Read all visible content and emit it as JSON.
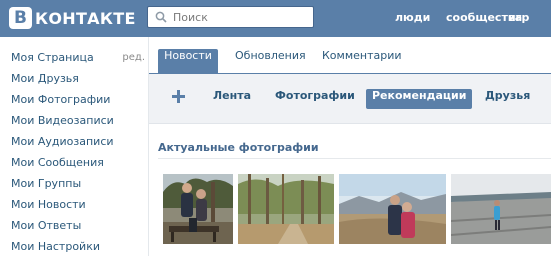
{
  "header": {
    "logo_letter": "В",
    "logo_text": "КОНТАКТЕ",
    "search_placeholder": "Поиск",
    "links": [
      "люди",
      "сообщества",
      "игр"
    ]
  },
  "left_menu": {
    "items": [
      {
        "label": "Моя Страница",
        "edit": "ред."
      },
      {
        "label": "Мои Друзья"
      },
      {
        "label": "Мои Фотографии"
      },
      {
        "label": "Мои Видеозаписи"
      },
      {
        "label": "Мои Аудиозаписи"
      },
      {
        "label": "Мои Сообщения"
      },
      {
        "label": "Мои Группы"
      },
      {
        "label": "Мои Новости"
      },
      {
        "label": "Мои Ответы"
      },
      {
        "label": "Мои Настройки"
      }
    ]
  },
  "tabs": [
    "Новости",
    "Обновления",
    "Комментарии"
  ],
  "filters": [
    "Лента",
    "Фотографии",
    "Рекомендации",
    "Друзья"
  ],
  "section_title": "Актуальные фотографии",
  "photos": [
    {
      "icon": "photo-people-bench"
    },
    {
      "icon": "photo-forest"
    },
    {
      "icon": "photo-couple-mountains"
    },
    {
      "icon": "photo-woman-pier"
    }
  ],
  "colors": {
    "header": "#5a7fa8",
    "link": "#2b587a",
    "active_tab": "#5a7fa8",
    "filter_bg": "#f0f2f5"
  }
}
